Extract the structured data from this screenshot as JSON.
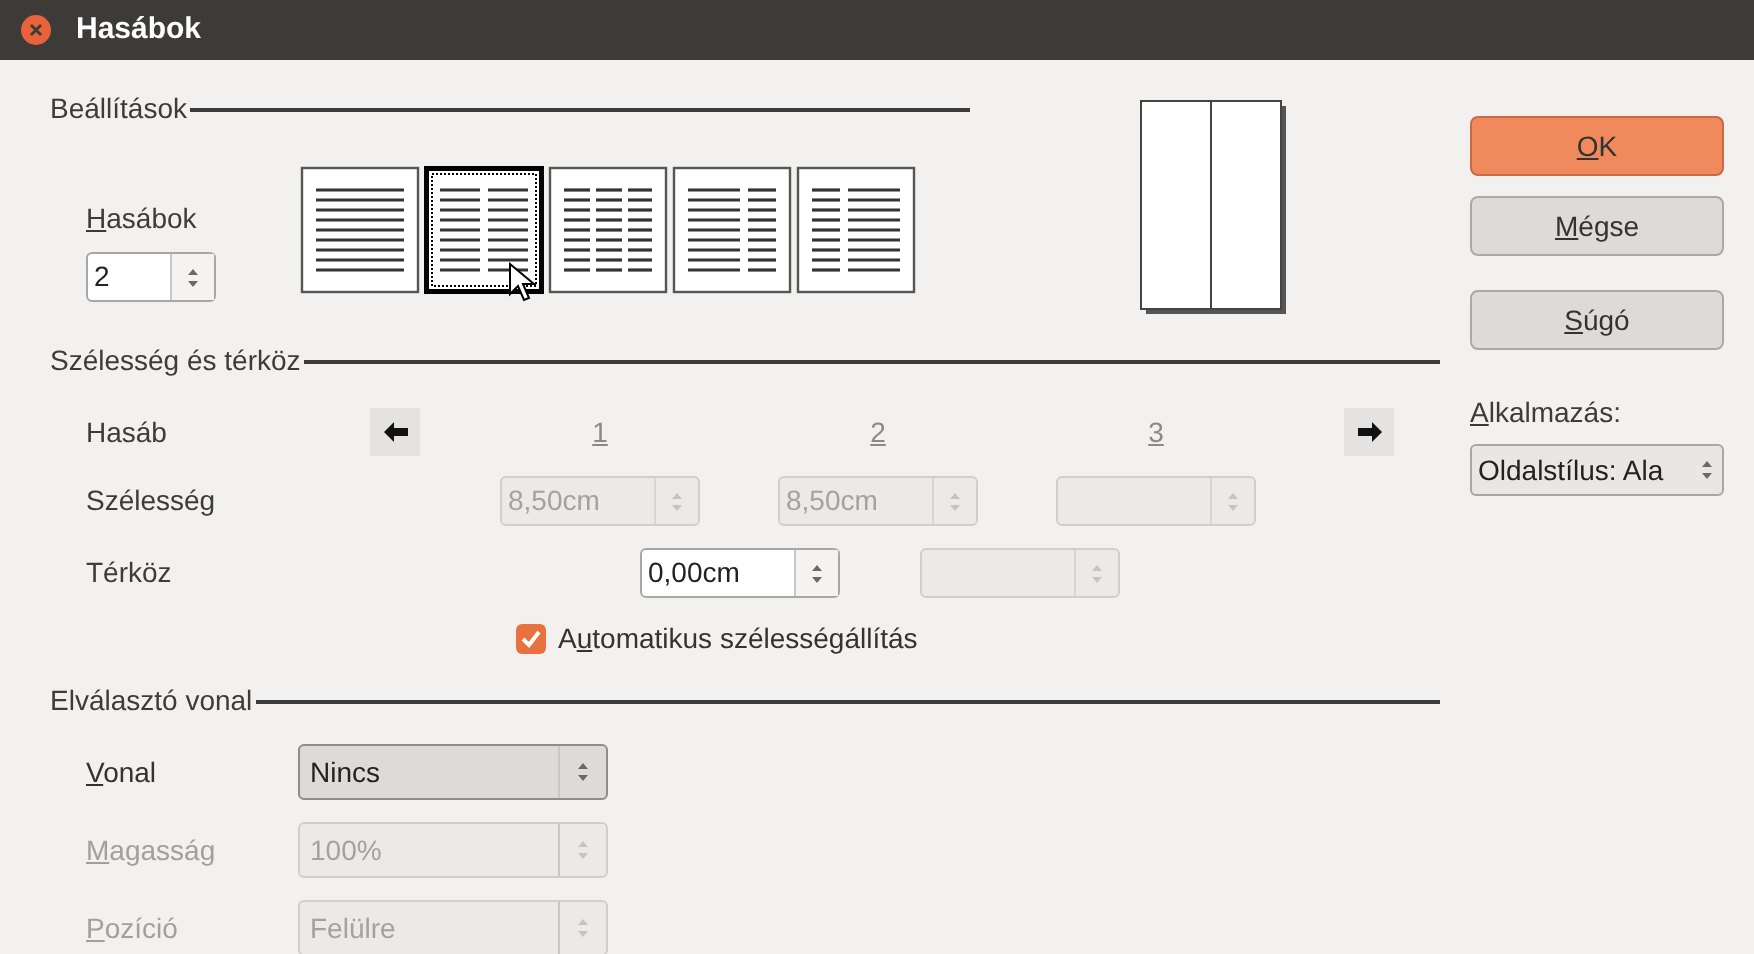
{
  "window": {
    "title": "Hasábok"
  },
  "settings": {
    "title": "Beállítások",
    "columns_label": {
      "key": "H",
      "rest": "asábok"
    },
    "columns_value": "2",
    "presets": [
      {
        "kind": "one",
        "selected": false
      },
      {
        "kind": "two",
        "selected": true
      },
      {
        "kind": "three",
        "selected": false
      },
      {
        "kind": "left",
        "selected": false
      },
      {
        "kind": "right",
        "selected": false
      }
    ]
  },
  "buttons": [
    {
      "label": {
        "key": "O",
        "rest": "K"
      },
      "kind": "primary"
    },
    {
      "label": {
        "key": "M",
        "rest": "égse"
      },
      "kind": "normal"
    },
    {
      "label": {
        "key": "S",
        "rest": "úgó"
      },
      "kind": "normal"
    }
  ],
  "apply": {
    "label": {
      "key": "A",
      "rest": "lkalmazás:"
    },
    "value": "Oldalstílus: Ala"
  },
  "width_spacing": {
    "title": "Szélesség és térköz",
    "column_label": "Hasáb",
    "column_numbers": [
      "1",
      "2",
      "3"
    ],
    "width_label": "Szélesség",
    "widths": [
      {
        "value": "8,50cm",
        "disabled": true
      },
      {
        "value": "8,50cm",
        "disabled": true
      },
      {
        "disabled": true
      }
    ],
    "spacing_label": "Térköz",
    "spacings": [
      {
        "value": "0,00cm",
        "disabled": false
      },
      {
        "disabled": true
      }
    ],
    "autowidth": {
      "label": {
        "pre": "A",
        "key": "u",
        "rest": "tomatikus szélességállítás"
      },
      "checked": true
    }
  },
  "separator": {
    "title": "Elválasztó vonal",
    "rows": [
      {
        "label": {
          "key": "V",
          "rest": "onal"
        },
        "value": "Nincs",
        "disabled": false
      },
      {
        "label": {
          "key": "M",
          "rest": "agasság"
        },
        "value": "100%",
        "disabled": true
      },
      {
        "label": {
          "key": "P",
          "rest": "ozíció"
        },
        "value": "Felülre",
        "disabled": true
      }
    ]
  }
}
